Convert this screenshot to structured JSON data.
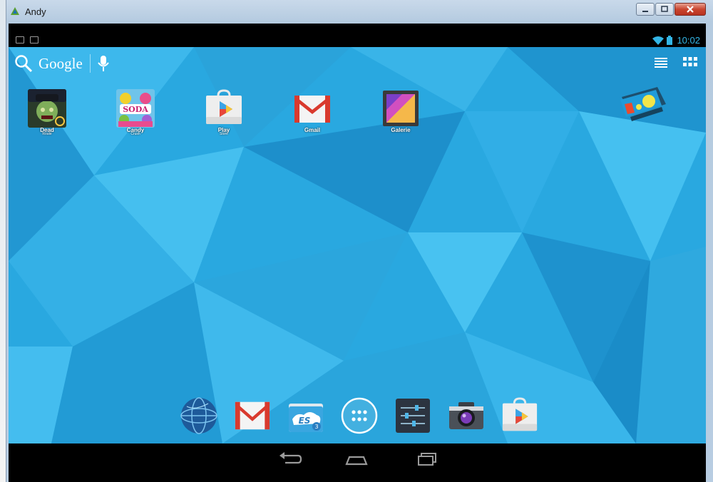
{
  "window": {
    "title": "Andy",
    "controls": {
      "minimize": "minimize",
      "maximize": "maximize",
      "close": "close"
    }
  },
  "status_bar": {
    "time": "10:02",
    "icons": [
      "screenshot-icon",
      "briefcase-icon",
      "wifi-icon",
      "battery-icon"
    ]
  },
  "search": {
    "label": "Google",
    "icons": [
      "search-icon",
      "mic-icon"
    ]
  },
  "top_right_icons": [
    "list-icon",
    "apps-grid-icon"
  ],
  "home_apps": [
    {
      "name": "Dead",
      "sublabel": "Route",
      "icon": "zombie-game-icon"
    },
    {
      "name": "Candy",
      "sublabel": "Crush",
      "icon": "candy-game-icon",
      "logo_text": "SODA"
    },
    {
      "name": "Play",
      "sublabel": "Store",
      "icon": "play-store-icon"
    },
    {
      "name": "Gmail",
      "icon": "gmail-icon"
    },
    {
      "name": "Galerie",
      "icon": "gallery-icon"
    }
  ],
  "widget": {
    "icon": "andy-remote-icon"
  },
  "dock": [
    {
      "icon": "browser-globe-icon"
    },
    {
      "icon": "gmail-icon"
    },
    {
      "icon": "es-file-explorer-icon",
      "logo_text": "ES",
      "badge": "3"
    },
    {
      "icon": "all-apps-icon"
    },
    {
      "icon": "settings-icon"
    },
    {
      "icon": "camera-icon"
    },
    {
      "icon": "play-store-icon"
    }
  ],
  "nav_bar": [
    "back-icon",
    "home-icon",
    "recents-icon"
  ],
  "colors": {
    "wallpaper": "#29a8e0",
    "status_accent": "#33b5e5",
    "gmail_red": "#d93a2e"
  }
}
